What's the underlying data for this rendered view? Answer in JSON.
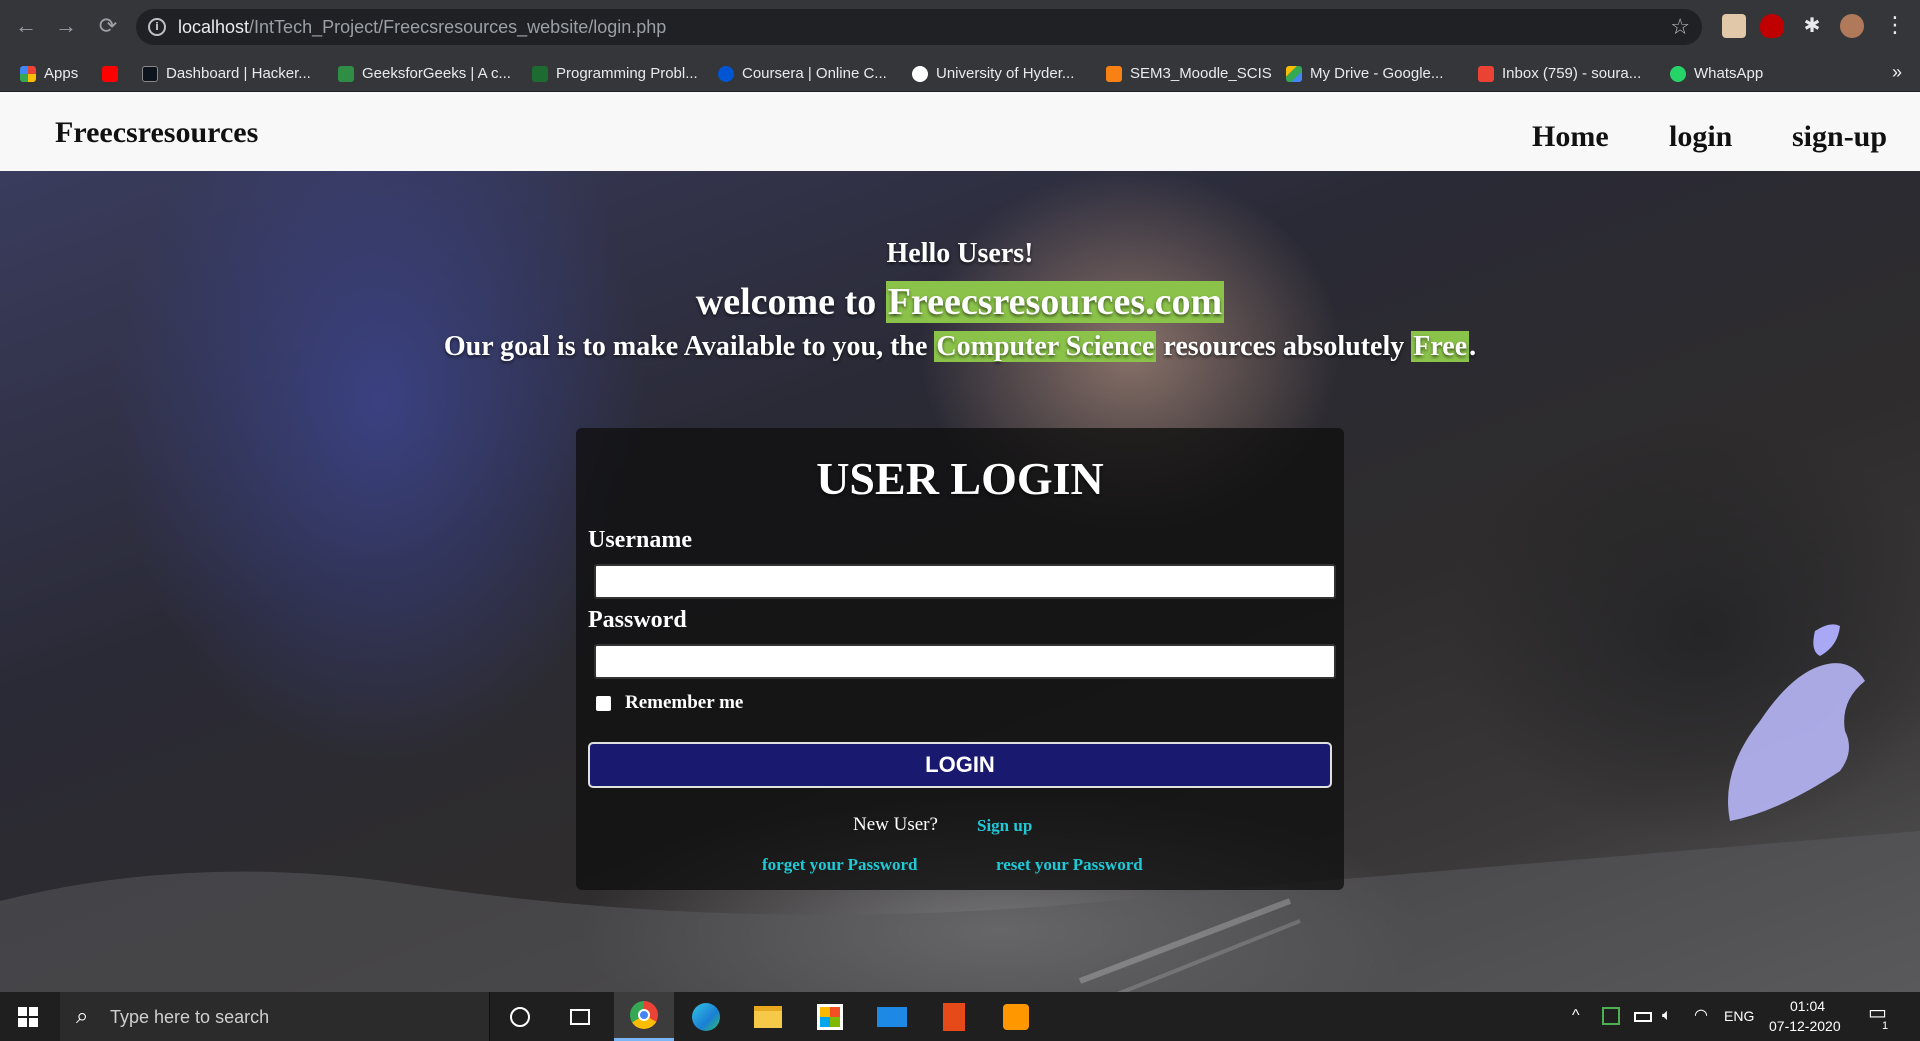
{
  "browser": {
    "url_host": "localhost",
    "url_path": "/IntTech_Project/Freecsresources_website/login.php",
    "bookmarks": [
      {
        "label": "Apps",
        "icon": "apps-grid-icon",
        "color": "#f4b400"
      },
      {
        "label": "",
        "icon": "youtube-icon",
        "color": "#ff0000"
      },
      {
        "label": "Dashboard | Hacker...",
        "icon": "hackerrank-icon",
        "color": "#000000"
      },
      {
        "label": "GeeksforGeeks | A c...",
        "icon": "geeksforgeeks-icon",
        "color": "#2f8d46"
      },
      {
        "label": "Programming Probl...",
        "icon": "leaf-icon",
        "color": "#2f8d46"
      },
      {
        "label": "Coursera | Online C...",
        "icon": "coursera-icon",
        "color": "#0056d2"
      },
      {
        "label": "University of Hyder...",
        "icon": "globe-icon",
        "color": "#ffffff"
      },
      {
        "label": "SEM3_Moodle_SCIS",
        "icon": "moodle-icon",
        "color": "#f98012"
      },
      {
        "label": "My Drive - Google...",
        "icon": "google-drive-icon",
        "color": "#fbbc04"
      },
      {
        "label": "Inbox (759) - soura...",
        "icon": "gmail-icon",
        "color": "#ea4335"
      },
      {
        "label": "WhatsApp",
        "icon": "whatsapp-icon",
        "color": "#25d366"
      }
    ]
  },
  "site": {
    "brand": "Freecsresources",
    "nav": [
      "Home",
      "login",
      "sign-up"
    ]
  },
  "hero": {
    "greeting": "Hello Users!",
    "welcome_prefix": "welcome to ",
    "welcome_domain": "Freecsresources.com",
    "goal_prefix": "Our goal is to make Available to you, the ",
    "goal_highlight": "Computer Science",
    "goal_middle": " resources absolutely ",
    "goal_free": "Free",
    "goal_suffix": "."
  },
  "login_form": {
    "title": "USER LOGIN",
    "username_label": "Username",
    "username_value": "",
    "password_label": "Password",
    "password_value": "",
    "remember_label": "Remember me",
    "remember_checked": false,
    "login_button": "LOGIN",
    "new_user_text": "New User?",
    "signup_link": "Sign up",
    "forget_link": "forget your Password",
    "reset_link": "reset your Password"
  },
  "taskbar": {
    "search_placeholder": "Type here to search",
    "language": "ENG",
    "time": "01:04",
    "date": "07-12-2020",
    "notification_count": "1"
  },
  "colors": {
    "highlight": "#8bc34a",
    "login_button": "#191970",
    "link": "#1fc9d6"
  }
}
